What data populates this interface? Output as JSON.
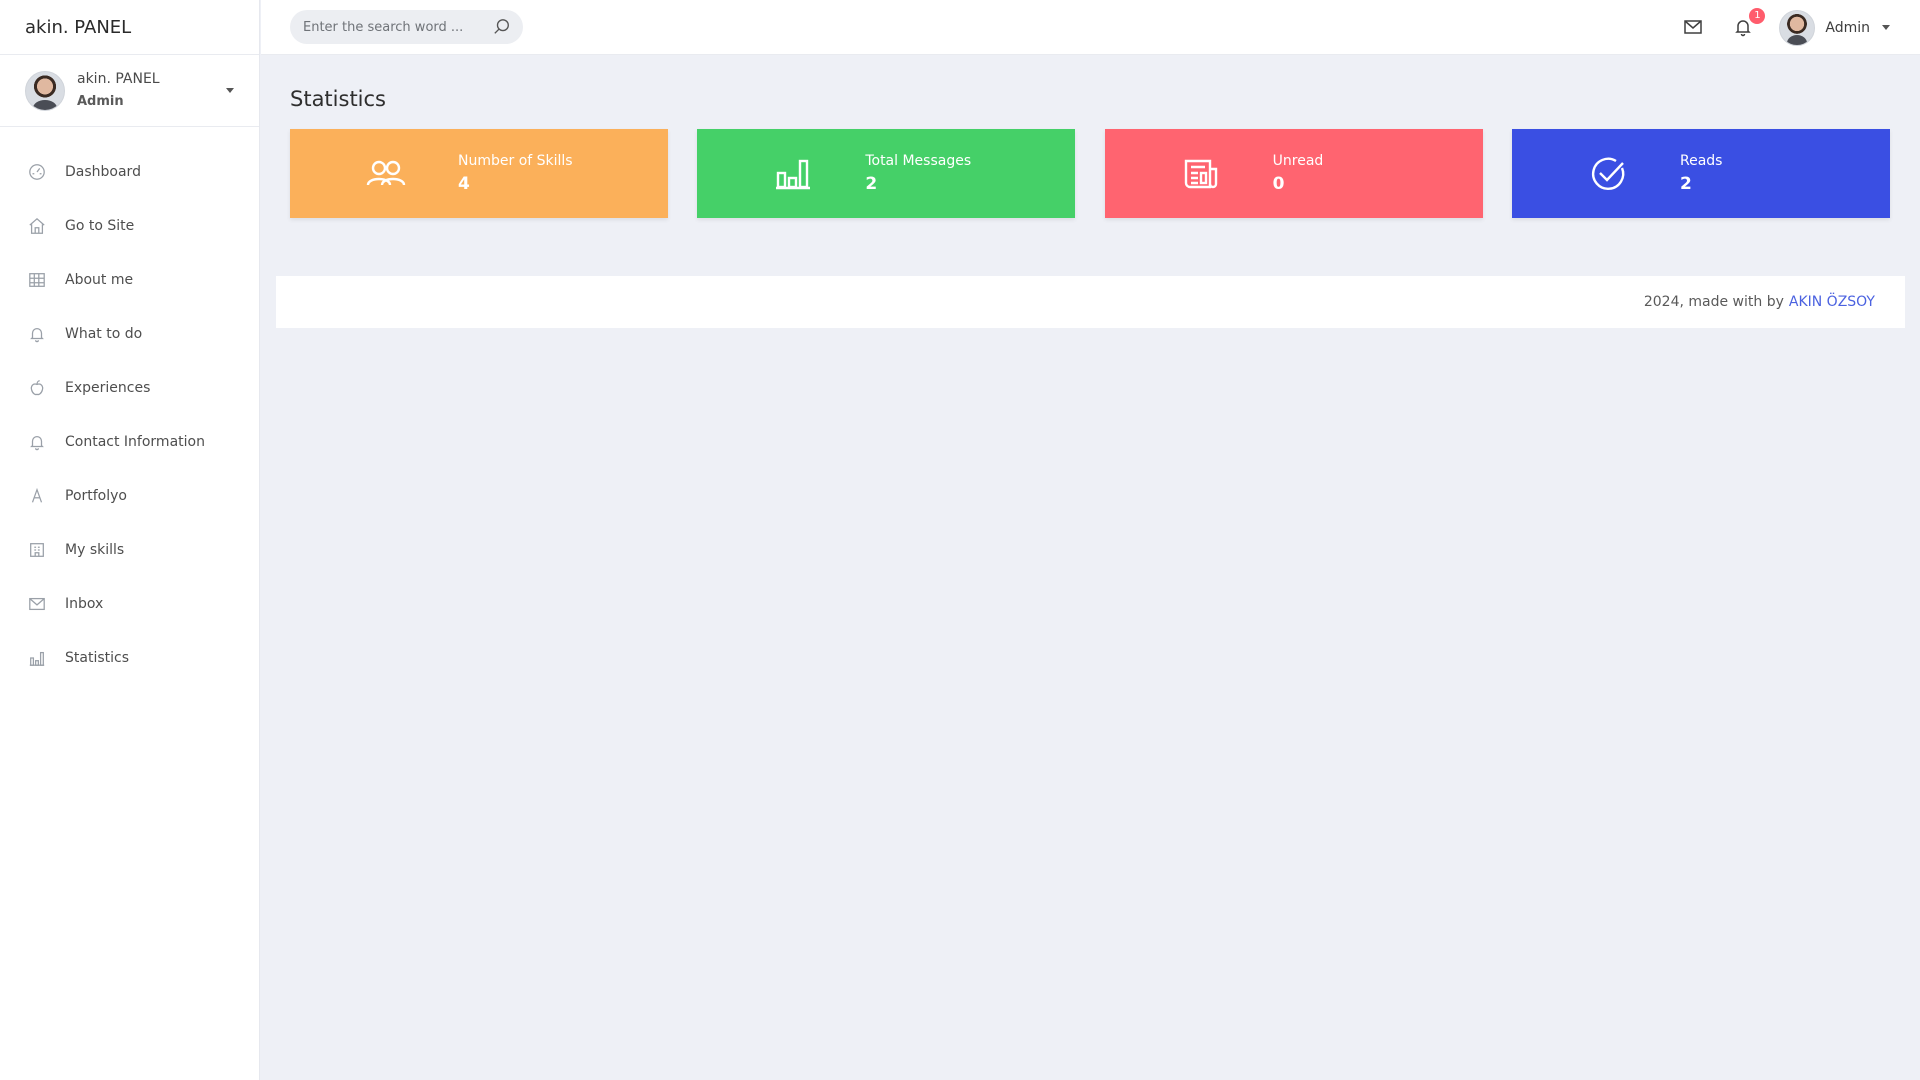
{
  "brand": "akin. PANEL",
  "profile": {
    "name": "akin. PANEL",
    "role": "Admin"
  },
  "sidebar": {
    "items": [
      {
        "label": "Dashboard",
        "icon": "gauge-icon"
      },
      {
        "label": "Go to Site",
        "icon": "home-icon"
      },
      {
        "label": "About me",
        "icon": "grid-icon"
      },
      {
        "label": "What to do",
        "icon": "bell-icon"
      },
      {
        "label": "Experiences",
        "icon": "apple-icon"
      },
      {
        "label": "Contact Information",
        "icon": "bell-icon"
      },
      {
        "label": "Portfolyo",
        "icon": "font-a-icon"
      },
      {
        "label": "My skills",
        "icon": "building-icon"
      },
      {
        "label": "Inbox",
        "icon": "mail-icon"
      },
      {
        "label": "Statistics",
        "icon": "bar-chart-icon"
      }
    ]
  },
  "search": {
    "placeholder": "Enter the search word ..."
  },
  "topbar": {
    "notification_count": "1",
    "user_name": "Admin"
  },
  "page": {
    "title": "Statistics"
  },
  "cards": [
    {
      "label": "Number of Skills",
      "value": "4",
      "color": "#fbb05a",
      "icon": "users-icon"
    },
    {
      "label": "Total Messages",
      "value": "2",
      "color": "#45d068",
      "icon": "bar-chart-icon"
    },
    {
      "label": "Unread",
      "value": "0",
      "color": "#ff6470",
      "icon": "newspaper-icon"
    },
    {
      "label": "Reads",
      "value": "2",
      "color": "#3a4fe3",
      "icon": "check-circle-icon"
    }
  ],
  "footer": {
    "text": "2024, made with by",
    "link": "AKIN ÖZSOY"
  }
}
